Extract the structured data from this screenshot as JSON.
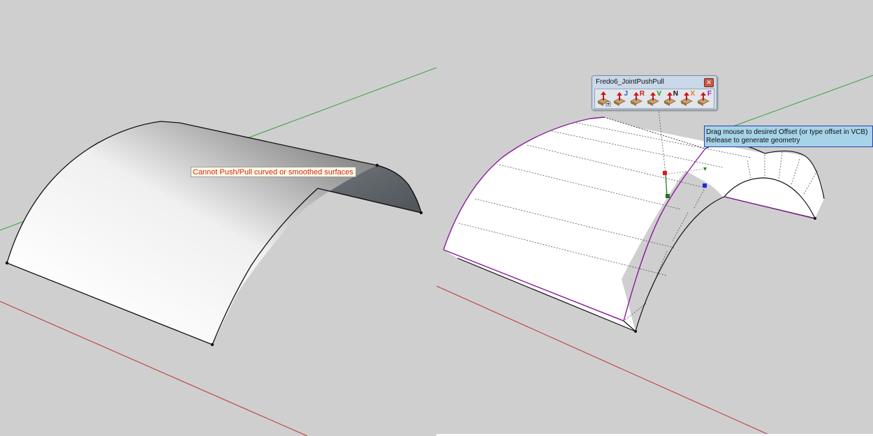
{
  "left_view": {
    "error_tooltip": "Cannot Push/Pull curved or smoothed surfaces"
  },
  "right_view": {
    "toolbar": {
      "title": "Fredo6_JointPushPull",
      "close_symbol": "✕",
      "tools": [
        {
          "letter": "",
          "color": "#c81818",
          "icon": "push-pull-dropdown-icon"
        },
        {
          "letter": "J",
          "color": "#1d5fd0",
          "icon": "joint-push-pull-icon"
        },
        {
          "letter": "R",
          "color": "#d01818",
          "icon": "round-push-pull-icon"
        },
        {
          "letter": "V",
          "color": "#1a9a1a",
          "icon": "vector-push-pull-icon"
        },
        {
          "letter": "N",
          "color": "#111111",
          "icon": "normal-push-pull-icon"
        },
        {
          "letter": "X",
          "color": "#e08010",
          "icon": "extrude-push-pull-icon"
        },
        {
          "letter": "F",
          "color": "#a018b0",
          "icon": "follow-push-pull-icon"
        }
      ]
    },
    "status_hint": {
      "line1": "Drag mouse to desired Offset (or type offset in VCB)",
      "line2": "Release to generate geometry"
    }
  },
  "colors": {
    "background": "#cfcfcf",
    "axis_red": "#c03030",
    "axis_green": "#3aa03a",
    "selection_purple": "#8a1a9a"
  }
}
